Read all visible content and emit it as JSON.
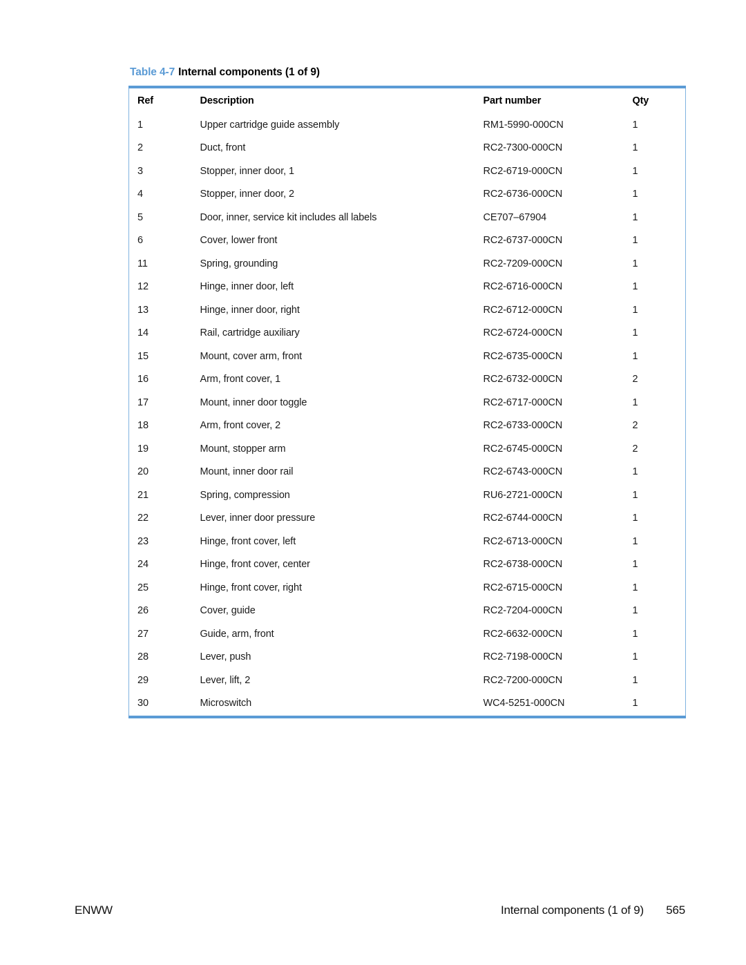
{
  "table": {
    "caption_number": "Table 4-7",
    "caption_title": "Internal components (1 of 9)",
    "accent_color": "#5B9BD5",
    "border_color": "#7FB2E0",
    "columns": [
      {
        "key": "ref",
        "label": "Ref"
      },
      {
        "key": "description",
        "label": "Description"
      },
      {
        "key": "part_number",
        "label": "Part number"
      },
      {
        "key": "qty",
        "label": "Qty"
      }
    ],
    "rows": [
      {
        "ref": "1",
        "description": "Upper cartridge guide assembly",
        "part_number": "RM1-5990-000CN",
        "qty": "1"
      },
      {
        "ref": "2",
        "description": "Duct, front",
        "part_number": "RC2-7300-000CN",
        "qty": "1"
      },
      {
        "ref": "3",
        "description": "Stopper, inner door, 1",
        "part_number": "RC2-6719-000CN",
        "qty": "1"
      },
      {
        "ref": "4",
        "description": "Stopper, inner door, 2",
        "part_number": "RC2-6736-000CN",
        "qty": "1"
      },
      {
        "ref": "5",
        "description": "Door, inner, service kit includes all labels",
        "part_number": "CE707–67904",
        "qty": "1"
      },
      {
        "ref": "6",
        "description": "Cover, lower front",
        "part_number": "RC2-6737-000CN",
        "qty": "1"
      },
      {
        "ref": "11",
        "description": "Spring, grounding",
        "part_number": "RC2-7209-000CN",
        "qty": "1"
      },
      {
        "ref": "12",
        "description": "Hinge, inner door, left",
        "part_number": "RC2-6716-000CN",
        "qty": "1"
      },
      {
        "ref": "13",
        "description": "Hinge, inner door, right",
        "part_number": "RC2-6712-000CN",
        "qty": "1"
      },
      {
        "ref": "14",
        "description": "Rail, cartridge auxiliary",
        "part_number": "RC2-6724-000CN",
        "qty": "1"
      },
      {
        "ref": "15",
        "description": "Mount, cover arm, front",
        "part_number": "RC2-6735-000CN",
        "qty": "1"
      },
      {
        "ref": "16",
        "description": "Arm, front cover, 1",
        "part_number": "RC2-6732-000CN",
        "qty": "2"
      },
      {
        "ref": "17",
        "description": "Mount, inner door toggle",
        "part_number": "RC2-6717-000CN",
        "qty": "1"
      },
      {
        "ref": "18",
        "description": "Arm, front cover, 2",
        "part_number": "RC2-6733-000CN",
        "qty": "2"
      },
      {
        "ref": "19",
        "description": "Mount, stopper arm",
        "part_number": "RC2-6745-000CN",
        "qty": "2"
      },
      {
        "ref": "20",
        "description": "Mount, inner door rail",
        "part_number": "RC2-6743-000CN",
        "qty": "1"
      },
      {
        "ref": "21",
        "description": "Spring, compression",
        "part_number": "RU6-2721-000CN",
        "qty": "1"
      },
      {
        "ref": "22",
        "description": "Lever, inner door pressure",
        "part_number": "RC2-6744-000CN",
        "qty": "1"
      },
      {
        "ref": "23",
        "description": "Hinge, front cover, left",
        "part_number": "RC2-6713-000CN",
        "qty": "1"
      },
      {
        "ref": "24",
        "description": "Hinge, front cover, center",
        "part_number": "RC2-6738-000CN",
        "qty": "1"
      },
      {
        "ref": "25",
        "description": "Hinge, front cover, right",
        "part_number": "RC2-6715-000CN",
        "qty": "1"
      },
      {
        "ref": "26",
        "description": "Cover, guide",
        "part_number": "RC2-7204-000CN",
        "qty": "1"
      },
      {
        "ref": "27",
        "description": "Guide, arm, front",
        "part_number": "RC2-6632-000CN",
        "qty": "1"
      },
      {
        "ref": "28",
        "description": "Lever, push",
        "part_number": "RC2-7198-000CN",
        "qty": "1"
      },
      {
        "ref": "29",
        "description": "Lever, lift, 2",
        "part_number": "RC2-7200-000CN",
        "qty": "1"
      },
      {
        "ref": "30",
        "description": "Microswitch",
        "part_number": "WC4-5251-000CN",
        "qty": "1"
      }
    ]
  },
  "footer": {
    "left": "ENWW",
    "section": "Internal components (1 of 9)",
    "page_number": "565"
  }
}
